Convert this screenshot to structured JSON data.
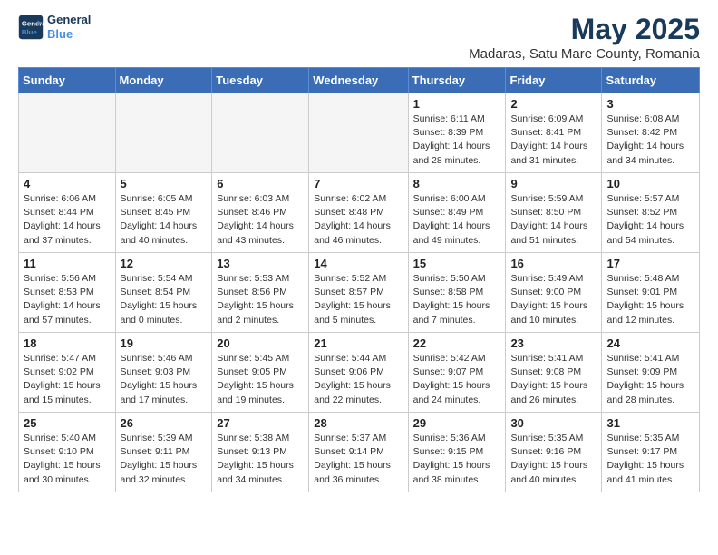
{
  "header": {
    "logo_line1": "General",
    "logo_line2": "Blue",
    "month": "May 2025",
    "location": "Madaras, Satu Mare County, Romania"
  },
  "weekdays": [
    "Sunday",
    "Monday",
    "Tuesday",
    "Wednesday",
    "Thursday",
    "Friday",
    "Saturday"
  ],
  "weeks": [
    [
      {
        "day": "",
        "detail": ""
      },
      {
        "day": "",
        "detail": ""
      },
      {
        "day": "",
        "detail": ""
      },
      {
        "day": "",
        "detail": ""
      },
      {
        "day": "1",
        "detail": "Sunrise: 6:11 AM\nSunset: 8:39 PM\nDaylight: 14 hours\nand 28 minutes."
      },
      {
        "day": "2",
        "detail": "Sunrise: 6:09 AM\nSunset: 8:41 PM\nDaylight: 14 hours\nand 31 minutes."
      },
      {
        "day": "3",
        "detail": "Sunrise: 6:08 AM\nSunset: 8:42 PM\nDaylight: 14 hours\nand 34 minutes."
      }
    ],
    [
      {
        "day": "4",
        "detail": "Sunrise: 6:06 AM\nSunset: 8:44 PM\nDaylight: 14 hours\nand 37 minutes."
      },
      {
        "day": "5",
        "detail": "Sunrise: 6:05 AM\nSunset: 8:45 PM\nDaylight: 14 hours\nand 40 minutes."
      },
      {
        "day": "6",
        "detail": "Sunrise: 6:03 AM\nSunset: 8:46 PM\nDaylight: 14 hours\nand 43 minutes."
      },
      {
        "day": "7",
        "detail": "Sunrise: 6:02 AM\nSunset: 8:48 PM\nDaylight: 14 hours\nand 46 minutes."
      },
      {
        "day": "8",
        "detail": "Sunrise: 6:00 AM\nSunset: 8:49 PM\nDaylight: 14 hours\nand 49 minutes."
      },
      {
        "day": "9",
        "detail": "Sunrise: 5:59 AM\nSunset: 8:50 PM\nDaylight: 14 hours\nand 51 minutes."
      },
      {
        "day": "10",
        "detail": "Sunrise: 5:57 AM\nSunset: 8:52 PM\nDaylight: 14 hours\nand 54 minutes."
      }
    ],
    [
      {
        "day": "11",
        "detail": "Sunrise: 5:56 AM\nSunset: 8:53 PM\nDaylight: 14 hours\nand 57 minutes."
      },
      {
        "day": "12",
        "detail": "Sunrise: 5:54 AM\nSunset: 8:54 PM\nDaylight: 15 hours\nand 0 minutes."
      },
      {
        "day": "13",
        "detail": "Sunrise: 5:53 AM\nSunset: 8:56 PM\nDaylight: 15 hours\nand 2 minutes."
      },
      {
        "day": "14",
        "detail": "Sunrise: 5:52 AM\nSunset: 8:57 PM\nDaylight: 15 hours\nand 5 minutes."
      },
      {
        "day": "15",
        "detail": "Sunrise: 5:50 AM\nSunset: 8:58 PM\nDaylight: 15 hours\nand 7 minutes."
      },
      {
        "day": "16",
        "detail": "Sunrise: 5:49 AM\nSunset: 9:00 PM\nDaylight: 15 hours\nand 10 minutes."
      },
      {
        "day": "17",
        "detail": "Sunrise: 5:48 AM\nSunset: 9:01 PM\nDaylight: 15 hours\nand 12 minutes."
      }
    ],
    [
      {
        "day": "18",
        "detail": "Sunrise: 5:47 AM\nSunset: 9:02 PM\nDaylight: 15 hours\nand 15 minutes."
      },
      {
        "day": "19",
        "detail": "Sunrise: 5:46 AM\nSunset: 9:03 PM\nDaylight: 15 hours\nand 17 minutes."
      },
      {
        "day": "20",
        "detail": "Sunrise: 5:45 AM\nSunset: 9:05 PM\nDaylight: 15 hours\nand 19 minutes."
      },
      {
        "day": "21",
        "detail": "Sunrise: 5:44 AM\nSunset: 9:06 PM\nDaylight: 15 hours\nand 22 minutes."
      },
      {
        "day": "22",
        "detail": "Sunrise: 5:42 AM\nSunset: 9:07 PM\nDaylight: 15 hours\nand 24 minutes."
      },
      {
        "day": "23",
        "detail": "Sunrise: 5:41 AM\nSunset: 9:08 PM\nDaylight: 15 hours\nand 26 minutes."
      },
      {
        "day": "24",
        "detail": "Sunrise: 5:41 AM\nSunset: 9:09 PM\nDaylight: 15 hours\nand 28 minutes."
      }
    ],
    [
      {
        "day": "25",
        "detail": "Sunrise: 5:40 AM\nSunset: 9:10 PM\nDaylight: 15 hours\nand 30 minutes."
      },
      {
        "day": "26",
        "detail": "Sunrise: 5:39 AM\nSunset: 9:11 PM\nDaylight: 15 hours\nand 32 minutes."
      },
      {
        "day": "27",
        "detail": "Sunrise: 5:38 AM\nSunset: 9:13 PM\nDaylight: 15 hours\nand 34 minutes."
      },
      {
        "day": "28",
        "detail": "Sunrise: 5:37 AM\nSunset: 9:14 PM\nDaylight: 15 hours\nand 36 minutes."
      },
      {
        "day": "29",
        "detail": "Sunrise: 5:36 AM\nSunset: 9:15 PM\nDaylight: 15 hours\nand 38 minutes."
      },
      {
        "day": "30",
        "detail": "Sunrise: 5:35 AM\nSunset: 9:16 PM\nDaylight: 15 hours\nand 40 minutes."
      },
      {
        "day": "31",
        "detail": "Sunrise: 5:35 AM\nSunset: 9:17 PM\nDaylight: 15 hours\nand 41 minutes."
      }
    ]
  ]
}
